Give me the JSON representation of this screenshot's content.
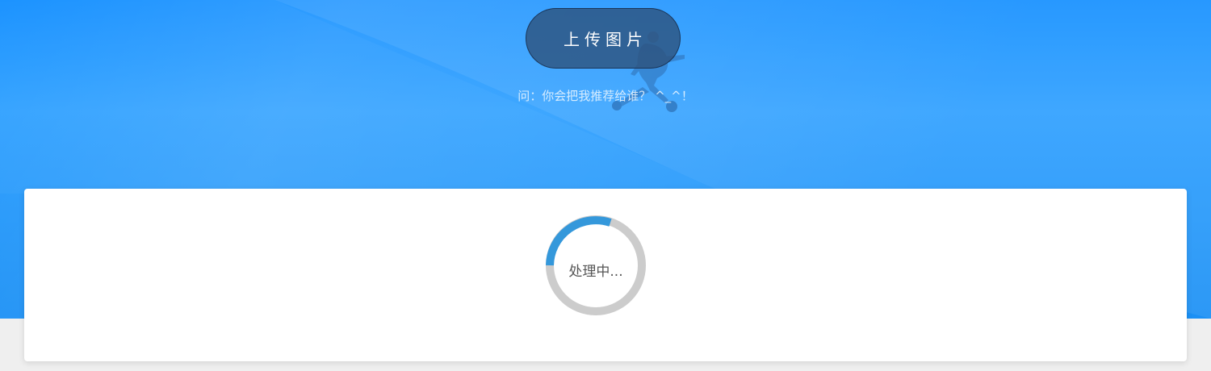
{
  "upload": {
    "button_label": "上传图片",
    "question": "问：你会把我推荐给谁？ ^_^！"
  },
  "status": {
    "text": "处理中...",
    "progress_color": "#3498db",
    "track_color": "#cccccc"
  },
  "theme": {
    "hero_color": "#1e96ff",
    "card_color": "#ffffff"
  },
  "icons": {
    "mascot": "running-person-illustration"
  }
}
